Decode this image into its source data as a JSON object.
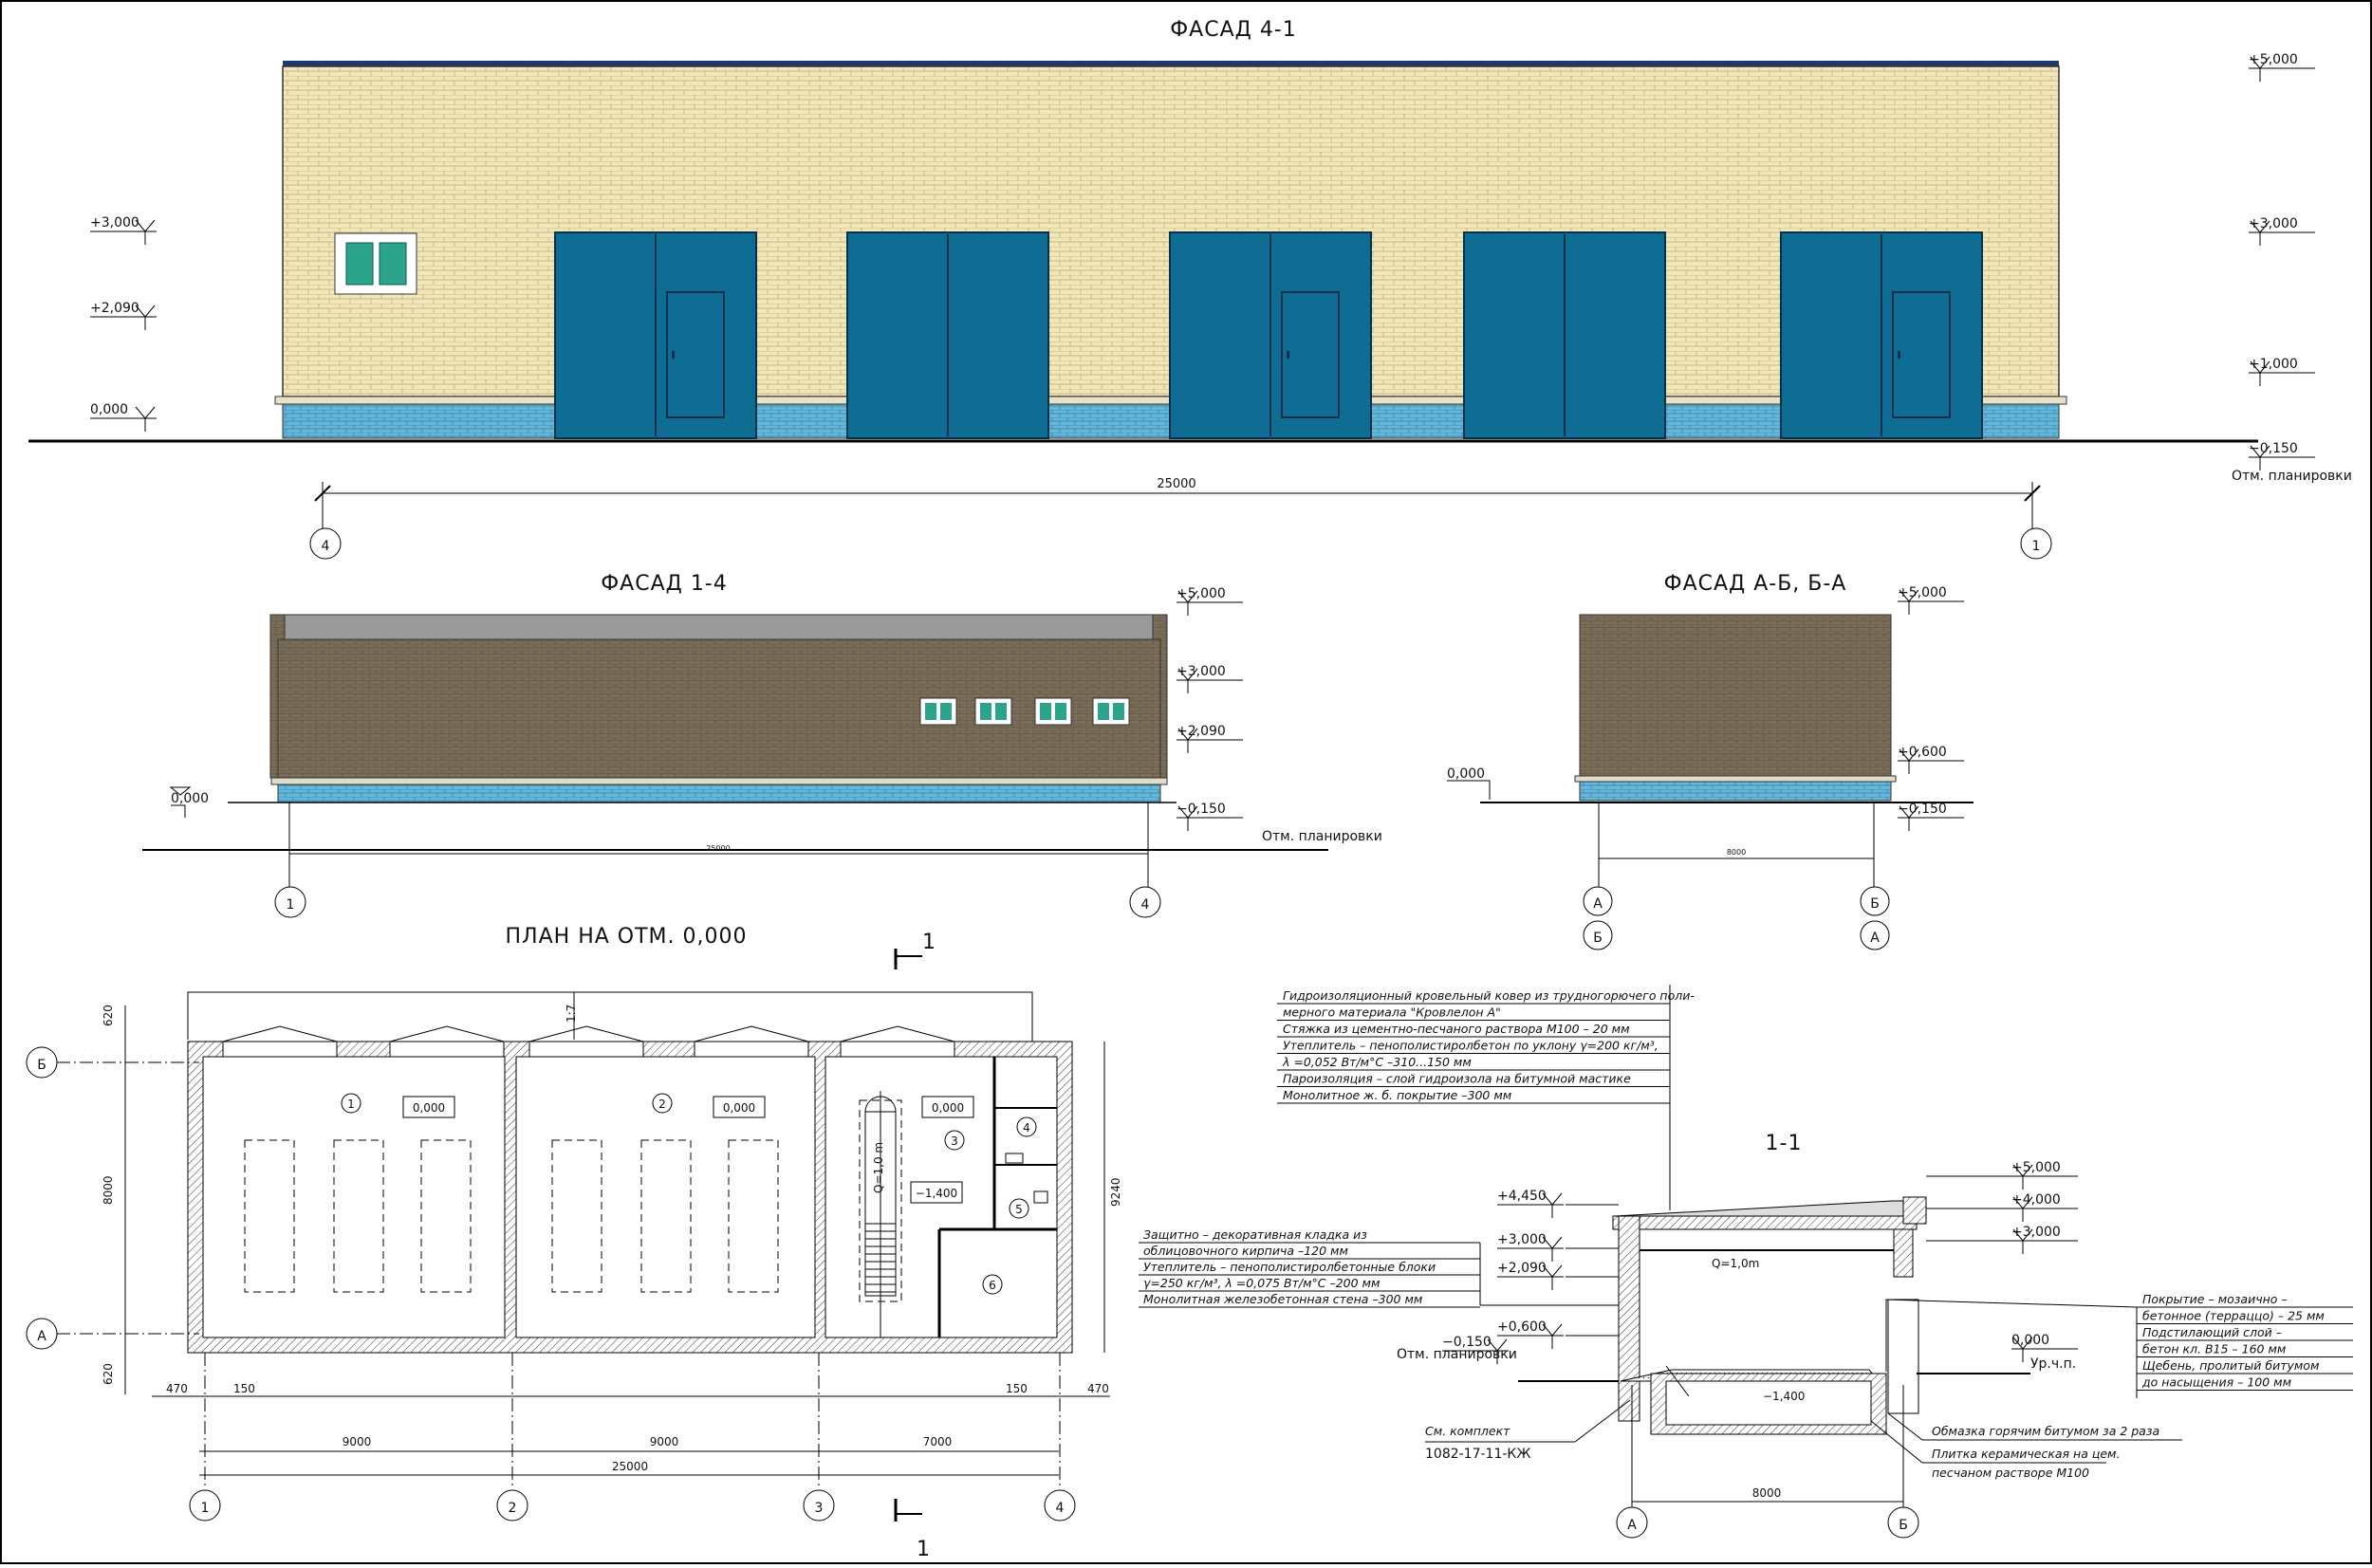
{
  "facade_41": {
    "title": "ФАСАД 4-1",
    "levels_left": [
      "+3,000",
      "+2,090",
      "0,000"
    ],
    "levels_right": [
      "+5,000",
      "+3,000",
      "+1,000",
      "−0,150"
    ],
    "grade_label": "Отм. планировки",
    "dimension": "25000",
    "axes": [
      "4",
      "1"
    ]
  },
  "facade_14": {
    "title": "ФАСАД 1-4",
    "levels": [
      "+5,000",
      "+3,000",
      "+2,090",
      "−0,150"
    ],
    "level_left": "0,000",
    "grade_label": "Отм. планировки",
    "dimension": "25000",
    "axes": [
      "1",
      "4"
    ]
  },
  "facade_ab": {
    "title": "ФАСАД А-Б, Б-А",
    "levels": [
      "+5,000",
      "+0,600",
      "−0,150"
    ],
    "level_left": "0,000",
    "dimension": "8000",
    "axes_top": [
      "А",
      "Б"
    ],
    "axes_bottom": [
      "Б",
      "А"
    ]
  },
  "plan": {
    "title": "ПЛАН НА ОТМ. 0,000",
    "section_mark": "1",
    "room_numbers": [
      "1",
      "2",
      "3",
      "4",
      "5",
      "6"
    ],
    "level_tags": [
      "0,000",
      "0,000",
      "0,000"
    ],
    "pit_level": "−1,400",
    "crane_label": "Q=1,0 m",
    "slope_label": "1:7",
    "dims_vertical": [
      "620",
      "8000",
      "620",
      "9240"
    ],
    "dims_bottom": [
      "470",
      "150",
      "150",
      "470",
      "9000",
      "9000",
      "7000",
      "25000"
    ],
    "axes_rows": [
      "Б",
      "А"
    ],
    "axes_cols": [
      "1",
      "2",
      "3",
      "4"
    ]
  },
  "section": {
    "title": "1-1",
    "roof_layers": [
      "Гидроизоляционный кровельный ковер из трудногорючего поли-",
      "мерного материала \"Кровлелон А\"",
      "Стяжка из цементно-песчаного раствора М100     – 20 мм",
      "Утеплитель – пенополистиролбетон по уклону γ=200 кг/м³,",
      "λ =0,052 Вт/м°С                                   –310...150 мм",
      "Пароизоляция – слой гидроизола на битумной мастике",
      "Монолитное ж. б. покрытие                        –300 мм"
    ],
    "wall_layers": [
      "Защитно – декоративная кладка из",
      "облицовочного кирпича                          –120 мм",
      "Утеплитель – пенополистиролбетонные блоки",
      "γ=250 кг/м³, λ =0,075 Вт/м°С              –200 мм",
      "Монолитная железобетонная стена            –300 мм"
    ],
    "floor_layers": [
      "Покрытие – мозаично –",
      "бетонное (терраццо) – 25 мм",
      "Подстилающий слой –",
      "бетон кл. В15        – 160 мм",
      "Щебень, пролитый битумом",
      "до насыщения        – 100 мм"
    ],
    "levels_left": [
      "+4,450",
      "+3,000",
      "+2,090",
      "+0,600",
      "−0,150"
    ],
    "levels_right": [
      "+5,000",
      "+4,000",
      "+3,000",
      "0,000"
    ],
    "grade_label": "Отм. планировки",
    "ground_label": "Ур.ч.п.",
    "crane": "Q=1,0m",
    "pit": "−1,400",
    "note_bitumen": "Обмазка горячим битумом за 2 раза",
    "note_tile_1": "Плитка керамическая на цем.",
    "note_tile_2": "песчаном растворе М100",
    "ref_1": "См. комплект",
    "ref_2": "1082-17-11-КЖ",
    "dimension": "8000",
    "axes": [
      "А",
      "Б"
    ]
  },
  "colors": {
    "brick_light": "#f2e7b8",
    "brick_dark": "#7a6d58",
    "door_blue": "#0f6c93",
    "plinth_blue": "#66b7d9",
    "window_green": "#2aa58b"
  }
}
